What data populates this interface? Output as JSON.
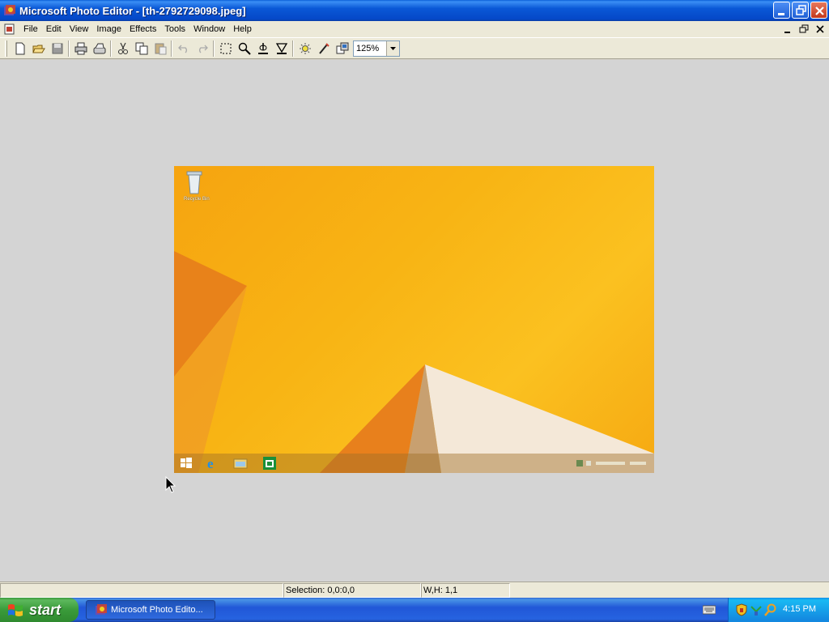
{
  "window": {
    "title": "Microsoft Photo Editor - [th-2792729098.jpeg]"
  },
  "menu": {
    "items": [
      "File",
      "Edit",
      "View",
      "Image",
      "Effects",
      "Tools",
      "Window",
      "Help"
    ]
  },
  "toolbar": {
    "zoom_value": "125%",
    "icons": [
      "new-icon",
      "open-icon",
      "save-icon",
      "print-icon",
      "scan-icon",
      "cut-icon",
      "copy-icon",
      "paste-icon",
      "undo-icon",
      "redo-icon",
      "select-icon",
      "zoom-icon",
      "smudge-icon",
      "sharpen-icon",
      "balance-icon",
      "effects-icon",
      "properties-icon"
    ]
  },
  "image": {
    "recycle_bin_label": "Recycle Bin"
  },
  "statusbar": {
    "main": "",
    "selection": "Selection: 0,0:0,0",
    "wh": "W,H: 1,1"
  },
  "taskbar": {
    "start_label": "start",
    "task_label": "Microsoft Photo Edito...",
    "clock": "4:15 PM"
  },
  "colors": {
    "title_blue": "#0a58d6",
    "start_green": "#3a9b3a",
    "workspace": "#d4d4d4",
    "image_orange": "#f8b414"
  }
}
